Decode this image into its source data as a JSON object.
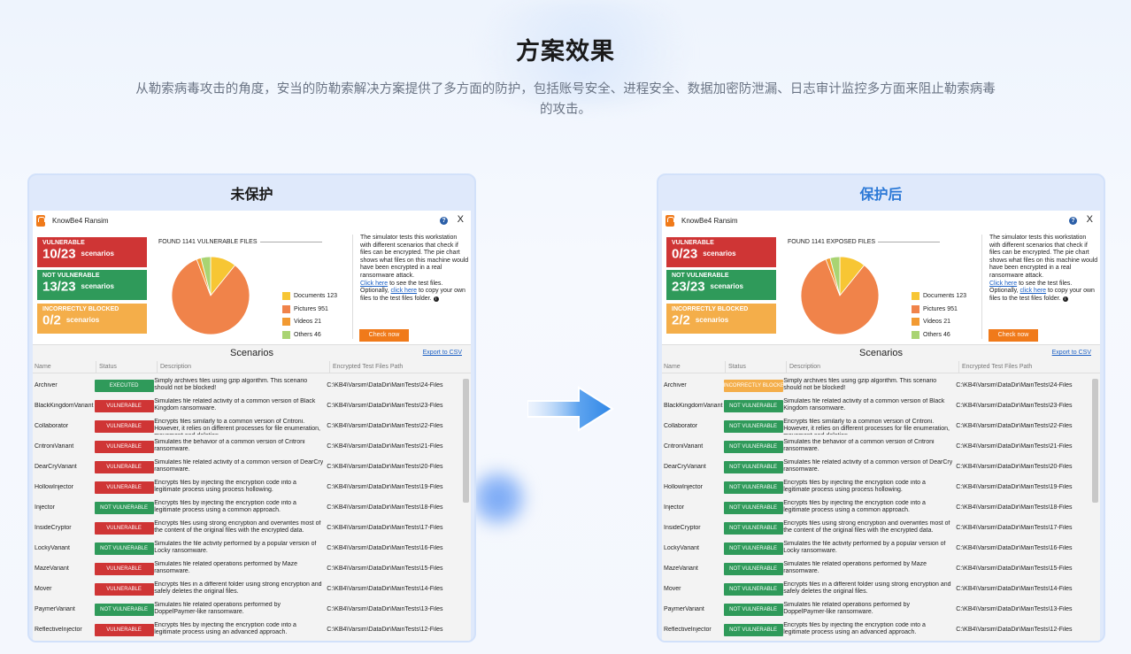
{
  "heading": "方案效果",
  "subtitle": "从勒索病毒攻击的角度，安当的防勒索解决方案提供了多方面的防护，包括账号安全、进程安全、数据加密防泄漏、日志审计监控多方面来阻止勒索病毒的攻击。",
  "colors": {
    "accent": "#2a78d6",
    "red": "#cf3535",
    "green": "#2f9a5a",
    "orange": "#f4ae4a",
    "button": "#f07a1a"
  },
  "panels": [
    {
      "title": "未保护",
      "app_name": "KnowBe4 Ransim",
      "boxes": [
        {
          "label": "VULNERABLE",
          "value": "10/23",
          "unit": "scenarios",
          "color": "red"
        },
        {
          "label": "NOT VULNERABLE",
          "value": "13/23",
          "unit": "scenarios",
          "color": "green"
        },
        {
          "label": "INCORRECTLY BLOCKED",
          "value": "0/2",
          "unit": "scenarios",
          "color": "orange"
        }
      ],
      "found_text": "FOUND 1141 VULNERABLE FILES",
      "legend": [
        {
          "label": "Documents 123",
          "color": "#f7c634",
          "value": 123
        },
        {
          "label": "Pictures 951",
          "color": "#f0834a",
          "value": 951
        },
        {
          "label": "Videos 21",
          "color": "#f29a32",
          "value": 21
        },
        {
          "label": "Others 46",
          "color": "#a9d472",
          "value": 46
        }
      ],
      "desc_text": "The simulator tests this workstation with different scenarios that check if files can be encrypted. The pie chart shows what files on this machine would have been encrypted in a real ransomware attack.",
      "click_here_1": "Click here",
      "desc_text2": " to see the test files.",
      "optionally": "Optionally, ",
      "click_here_2": "click here",
      "desc_text3": " to copy your own files to the test files folder. ",
      "check_btn": "Check now",
      "scenarios_title": "Scenarios",
      "export": "Export to CSV",
      "columns": [
        "Name",
        "Status",
        "Description",
        "Encrypted Test Files Path"
      ],
      "rows": [
        {
          "name": "Archiver",
          "status": "EXECUTED",
          "desc": "Simply archives files using gzip algorithm. This scenario should not be blocked!",
          "path": "C:\\KB4\\Varsim\\DataDir\\MainTests\\24-Files"
        },
        {
          "name": "BlackKingdomVariant",
          "status": "VULNERABLE",
          "desc": "Simulates file related activity of a common version of Black Kingdom ransomware.",
          "path": "C:\\KB4\\Varsim\\DataDir\\MainTests\\23-Files"
        },
        {
          "name": "Collaborator",
          "status": "VULNERABLE",
          "desc": "Encrypts files similarly to a common version of Critroni. However, it relies on different processes for file enumeration, movement and deletion.",
          "path": "C:\\KB4\\Varsim\\DataDir\\MainTests\\22-Files"
        },
        {
          "name": "CritroniVariant",
          "status": "VULNERABLE",
          "desc": "Simulates the behavior of a common version of Critroni ransomware.",
          "path": "C:\\KB4\\Varsim\\DataDir\\MainTests\\21-Files"
        },
        {
          "name": "DearCryVariant",
          "status": "VULNERABLE",
          "desc": "Simulates file related activity of a common version of DearCry ransomware.",
          "path": "C:\\KB4\\Varsim\\DataDir\\MainTests\\20-Files"
        },
        {
          "name": "HollowInjector",
          "status": "VULNERABLE",
          "desc": "Encrypts files by injecting the encryption code into a legitimate process using process hollowing.",
          "path": "C:\\KB4\\Varsim\\DataDir\\MainTests\\19-Files"
        },
        {
          "name": "Injector",
          "status": "NOT VULNERABLE",
          "desc": "Encrypts files by injecting the encryption code into a legitimate process using a common approach.",
          "path": "C:\\KB4\\Varsim\\DataDir\\MainTests\\18-Files"
        },
        {
          "name": "InsideCryptor",
          "status": "VULNERABLE",
          "desc": "Encrypts files using strong encryption and overwrites most of the content of the original files with the encrypted data.",
          "path": "C:\\KB4\\Varsim\\DataDir\\MainTests\\17-Files"
        },
        {
          "name": "LockyVariant",
          "status": "NOT VULNERABLE",
          "desc": "Simulates the file activity performed by a popular version of Locky ransomware.",
          "path": "C:\\KB4\\Varsim\\DataDir\\MainTests\\16-Files"
        },
        {
          "name": "MazeVariant",
          "status": "VULNERABLE",
          "desc": "Simulates file related operations performed by Maze ransomware.",
          "path": "C:\\KB4\\Varsim\\DataDir\\MainTests\\15-Files"
        },
        {
          "name": "Mover",
          "status": "VULNERABLE",
          "desc": "Encrypts files in a different folder using strong encryption and safely deletes the original files.",
          "path": "C:\\KB4\\Varsim\\DataDir\\MainTests\\14-Files"
        },
        {
          "name": "PaymerVariant",
          "status": "NOT VULNERABLE",
          "desc": "Simulates file related operations performed by DoppelPaymer-like ransomware.",
          "path": "C:\\KB4\\Varsim\\DataDir\\MainTests\\13-Files"
        },
        {
          "name": "ReflectiveInjector",
          "status": "VULNERABLE",
          "desc": "Encrypts files by injecting the encryption code into a legitimate process using an advanced approach.",
          "path": "C:\\KB4\\Varsim\\DataDir\\MainTests\\12-Files"
        }
      ]
    },
    {
      "title": "保护后",
      "app_name": "KnowBe4 Ransim",
      "boxes": [
        {
          "label": "VULNERABLE",
          "value": "0/23",
          "unit": "scenarios",
          "color": "red"
        },
        {
          "label": "NOT VULNERABLE",
          "value": "23/23",
          "unit": "scenarios",
          "color": "green"
        },
        {
          "label": "INCORRECTLY BLOCKED",
          "value": "2/2",
          "unit": "scenarios",
          "color": "orange"
        }
      ],
      "found_text": "FOUND 1141 EXPOSED FILES",
      "legend": [
        {
          "label": "Documents 123",
          "color": "#f7c634",
          "value": 123
        },
        {
          "label": "Pictures 951",
          "color": "#f0834a",
          "value": 951
        },
        {
          "label": "Videos 21",
          "color": "#f29a32",
          "value": 21
        },
        {
          "label": "Others 46",
          "color": "#a9d472",
          "value": 46
        }
      ],
      "desc_text": "The simulator tests this workstation with different scenarios that check if files can be encrypted. The pie chart shows what files on this machine would have been encrypted in a real ransomware attack.",
      "click_here_1": "Click here",
      "desc_text2": " to see the test files.",
      "optionally": "Optionally, ",
      "click_here_2": "click here",
      "desc_text3": " to copy your own files to the test files folder. ",
      "check_btn": "Check now",
      "scenarios_title": "Scenarios",
      "export": "Export to CSV",
      "columns": [
        "Name",
        "Status",
        "Description",
        "Encrypted Test Files Path"
      ],
      "rows": [
        {
          "name": "Archiver",
          "status": "INCORRECTLY BLOCKED",
          "desc": "Simply archives files using gzip algorithm. This scenario should not be blocked!",
          "path": "C:\\KB4\\Varsim\\DataDir\\MainTests\\24-Files"
        },
        {
          "name": "BlackKingdomVariant",
          "status": "NOT VULNERABLE",
          "desc": "Simulates file related activity of a common version of Black Kingdom ransomware.",
          "path": "C:\\KB4\\Varsim\\DataDir\\MainTests\\23-Files"
        },
        {
          "name": "Collaborator",
          "status": "NOT VULNERABLE",
          "desc": "Encrypts files similarly to a common version of Critroni. However, it relies on different processes for file enumeration, movement and deletion.",
          "path": "C:\\KB4\\Varsim\\DataDir\\MainTests\\22-Files"
        },
        {
          "name": "CritroniVariant",
          "status": "NOT VULNERABLE",
          "desc": "Simulates the behavior of a common version of Critroni ransomware.",
          "path": "C:\\KB4\\Varsim\\DataDir\\MainTests\\21-Files"
        },
        {
          "name": "DearCryVariant",
          "status": "NOT VULNERABLE",
          "desc": "Simulates file related activity of a common version of DearCry ransomware.",
          "path": "C:\\KB4\\Varsim\\DataDir\\MainTests\\20-Files"
        },
        {
          "name": "HollowInjector",
          "status": "NOT VULNERABLE",
          "desc": "Encrypts files by injecting the encryption code into a legitimate process using process hollowing.",
          "path": "C:\\KB4\\Varsim\\DataDir\\MainTests\\19-Files"
        },
        {
          "name": "Injector",
          "status": "NOT VULNERABLE",
          "desc": "Encrypts files by injecting the encryption code into a legitimate process using a common approach.",
          "path": "C:\\KB4\\Varsim\\DataDir\\MainTests\\18-Files"
        },
        {
          "name": "InsideCryptor",
          "status": "NOT VULNERABLE",
          "desc": "Encrypts files using strong encryption and overwrites most of the content of the original files with the encrypted data.",
          "path": "C:\\KB4\\Varsim\\DataDir\\MainTests\\17-Files"
        },
        {
          "name": "LockyVariant",
          "status": "NOT VULNERABLE",
          "desc": "Simulates the file activity performed by a popular version of Locky ransomware.",
          "path": "C:\\KB4\\Varsim\\DataDir\\MainTests\\16-Files"
        },
        {
          "name": "MazeVariant",
          "status": "NOT VULNERABLE",
          "desc": "Simulates file related operations performed by Maze ransomware.",
          "path": "C:\\KB4\\Varsim\\DataDir\\MainTests\\15-Files"
        },
        {
          "name": "Mover",
          "status": "NOT VULNERABLE",
          "desc": "Encrypts files in a different folder using strong encryption and safely deletes the original files.",
          "path": "C:\\KB4\\Varsim\\DataDir\\MainTests\\14-Files"
        },
        {
          "name": "PaymerVariant",
          "status": "NOT VULNERABLE",
          "desc": "Simulates file related operations performed by DoppelPaymer-like ransomware.",
          "path": "C:\\KB4\\Varsim\\DataDir\\MainTests\\13-Files"
        },
        {
          "name": "ReflectiveInjector",
          "status": "NOT VULNERABLE",
          "desc": "Encrypts files by injecting the encryption code into a legitimate process using an advanced approach.",
          "path": "C:\\KB4\\Varsim\\DataDir\\MainTests\\12-Files"
        }
      ]
    }
  ]
}
